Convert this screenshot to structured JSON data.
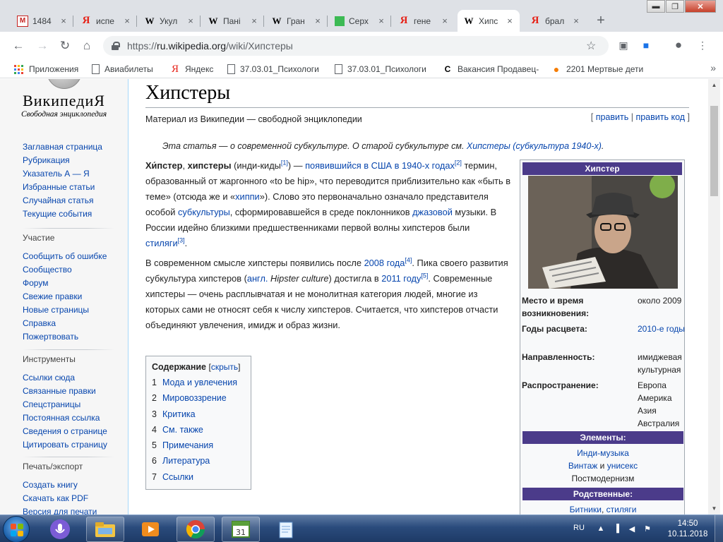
{
  "browser": {
    "tabs": [
      {
        "label": "1484",
        "icon": "gmail-icon"
      },
      {
        "label": "испе",
        "icon": "yandex-icon"
      },
      {
        "label": "Укул",
        "icon": "wikipedia-icon"
      },
      {
        "label": "Пані",
        "icon": "wikipedia-icon"
      },
      {
        "label": "Гран",
        "icon": "wikipedia-icon"
      },
      {
        "label": "Серх",
        "icon": "green-square-icon"
      },
      {
        "label": "гене",
        "icon": "yandex-icon"
      },
      {
        "label": "Хипс",
        "icon": "wikipedia-icon",
        "active": true
      },
      {
        "label": "брал",
        "icon": "yandex-icon"
      }
    ],
    "address": {
      "scheme": "https://",
      "host": "ru.wikipedia.org",
      "path": "/wiki/Хипстеры"
    },
    "bookmarks": [
      {
        "label": "Приложения",
        "icon": "apps-grid-icon"
      },
      {
        "label": "Авиабилеты",
        "icon": "document-icon"
      },
      {
        "label": "Яндекс",
        "icon": "yandex-icon"
      },
      {
        "label": "37.03.01_Психологи",
        "icon": "document-icon"
      },
      {
        "label": "37.03.01_Психологи",
        "icon": "document-icon"
      },
      {
        "label": "Вакансия Продавец-",
        "icon": "c-logo-icon"
      },
      {
        "label": "2201 Мертвые дети",
        "icon": "orange-logo-icon"
      }
    ]
  },
  "wiki": {
    "logo": {
      "wordmark": "ВикипедиЯ",
      "tagline": "Свободная энциклопедия"
    },
    "nav_main": [
      "Заглавная страница",
      "Рубрикация",
      "Указатель А — Я",
      "Избранные статьи",
      "Случайная статья",
      "Текущие события"
    ],
    "participation": {
      "heading": "Участие",
      "items": [
        "Сообщить об ошибке",
        "Сообщество",
        "Форум",
        "Свежие правки",
        "Новые страницы",
        "Справка",
        "Пожертвовать"
      ]
    },
    "tools": {
      "heading": "Инструменты",
      "items": [
        "Ссылки сюда",
        "Связанные правки",
        "Спецстраницы",
        "Постоянная ссылка",
        "Сведения о странице",
        "Цитировать страницу"
      ]
    },
    "print": {
      "heading": "Печать/экспорт",
      "items": [
        "Создать книгу",
        "Скачать как PDF",
        "Версия для печати"
      ]
    },
    "title": "Хипстеры",
    "site_sub": "Материал из Википедии — свободной энциклопедии",
    "edit": {
      "open": "[ ",
      "edit": "править",
      "sep": " | ",
      "edit_source": "править код",
      "close": " ]"
    },
    "hatnote": {
      "text": "Эта статья — о современной субкультуре. О старой субкультуре см. ",
      "link": "Хипстеры (субкультура 1940-х)",
      "end": "."
    },
    "p1": {
      "b1": "Хи́пстер",
      "t1": ", ",
      "b2": "хипстеры",
      "t2": " (инди-киды",
      "ref1": "[1]",
      "t3": ") — ",
      "l1": "появившийся в США в 1940-х годах",
      "ref2": "[2]",
      "t4": " термин, образованный от жаргонного «to be hip», что переводится приблизительно как «быть в теме» (отсюда же и «",
      "l2": "хиппи",
      "t5": "»). Слово это первоначально означало представителя особой ",
      "l3": "субкультуры",
      "t6": ", сформировавшейся в среде поклонников ",
      "l4": "джазовой",
      "t7": " музыки. В России идейно близкими предшественниками первой волны хипстеров были ",
      "l5": "стиляги",
      "ref3": "[3]",
      "t8": "."
    },
    "p2": {
      "t1": "В современном смысле хипстеры появились после ",
      "l1": "2008 года",
      "ref4": "[4]",
      "t2": ". Пика своего развития субкультура хипстеров (",
      "l2": "англ.",
      "t3": " ",
      "i1": "Hipster culture",
      "t4": ") достигла в ",
      "l3": "2011 году",
      "ref5": "[5]",
      "t5": ". Современные хипстеры — очень расплывчатая и не монолитная категория людей, многие из которых сами не относят себя к числу хипстеров. Считается, что хипстеров отчасти объединяют увлечения, имидж и образ жизни."
    },
    "toc": {
      "title": "Содержание",
      "toggle": {
        "open": "[",
        "label": "скрыть",
        "close": "]"
      },
      "items": [
        {
          "num": "1",
          "label": "Мода и увлечения"
        },
        {
          "num": "2",
          "label": "Мировоззрение"
        },
        {
          "num": "3",
          "label": "Критика"
        },
        {
          "num": "4",
          "label": "См. также"
        },
        {
          "num": "5",
          "label": "Примечания"
        },
        {
          "num": "6",
          "label": "Литература"
        },
        {
          "num": "7",
          "label": "Ссылки"
        }
      ]
    },
    "infobox": {
      "title": "Хипстер",
      "rows": [
        {
          "label": "Место и время возникновения:",
          "value": "около 2009"
        },
        {
          "label": "Годы расцвета:",
          "value": "2010-е годы",
          "link": true
        },
        {
          "label": "Направленность:",
          "value": "имиджевая культурная"
        },
        {
          "label": "Распространение:",
          "value": "Европа Америка Азия Австралия"
        }
      ],
      "elements_header": "Элементы:",
      "elements": {
        "a": "Инди-музыка",
        "b1": "Винтаж",
        "b2": " и ",
        "b3": "унисекс",
        "c": "Постмодернизм"
      },
      "related_header": "Родственные:",
      "related": {
        "a": "Битники",
        "sep": ", ",
        "b": "стиляги"
      },
      "accent": "#4b3b8a"
    }
  },
  "taskbar": {
    "apps": [
      "mic-icon",
      "explorer-icon",
      "media-icon",
      "chrome-icon",
      "calendar-icon",
      "notepad-icon"
    ],
    "lang": "RU",
    "time": "14:50",
    "date": "10.11.2018"
  }
}
